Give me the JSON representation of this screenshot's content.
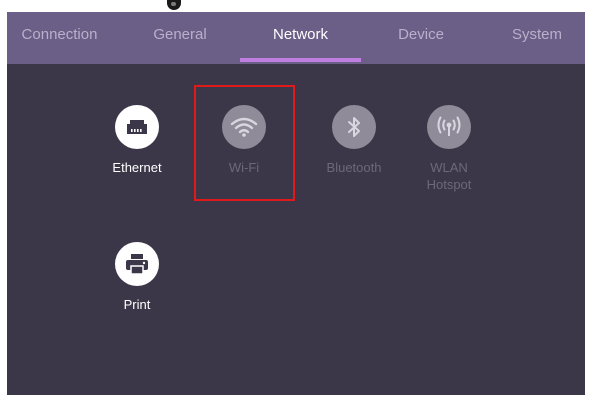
{
  "tabs": [
    {
      "label": "Connection",
      "active": false
    },
    {
      "label": "General",
      "active": false
    },
    {
      "label": "Network",
      "active": true
    },
    {
      "label": "Device",
      "active": false
    },
    {
      "label": "System",
      "active": false
    }
  ],
  "items": [
    {
      "label": "Ethernet",
      "icon": "ethernet-icon",
      "enabled": true
    },
    {
      "label": "Wi-Fi",
      "icon": "wifi-icon",
      "enabled": false,
      "highlighted": true
    },
    {
      "label": "Bluetooth",
      "icon": "bluetooth-icon",
      "enabled": false
    },
    {
      "label": "WLAN Hotspot",
      "icon": "hotspot-icon",
      "enabled": false
    },
    {
      "label": "Print",
      "icon": "printer-icon",
      "enabled": true
    }
  ],
  "colors": {
    "background": "#3b3748",
    "tab_bar": "#6b5e87",
    "active_underline": "#c07fe0",
    "highlight_box": "#e01a1a"
  }
}
